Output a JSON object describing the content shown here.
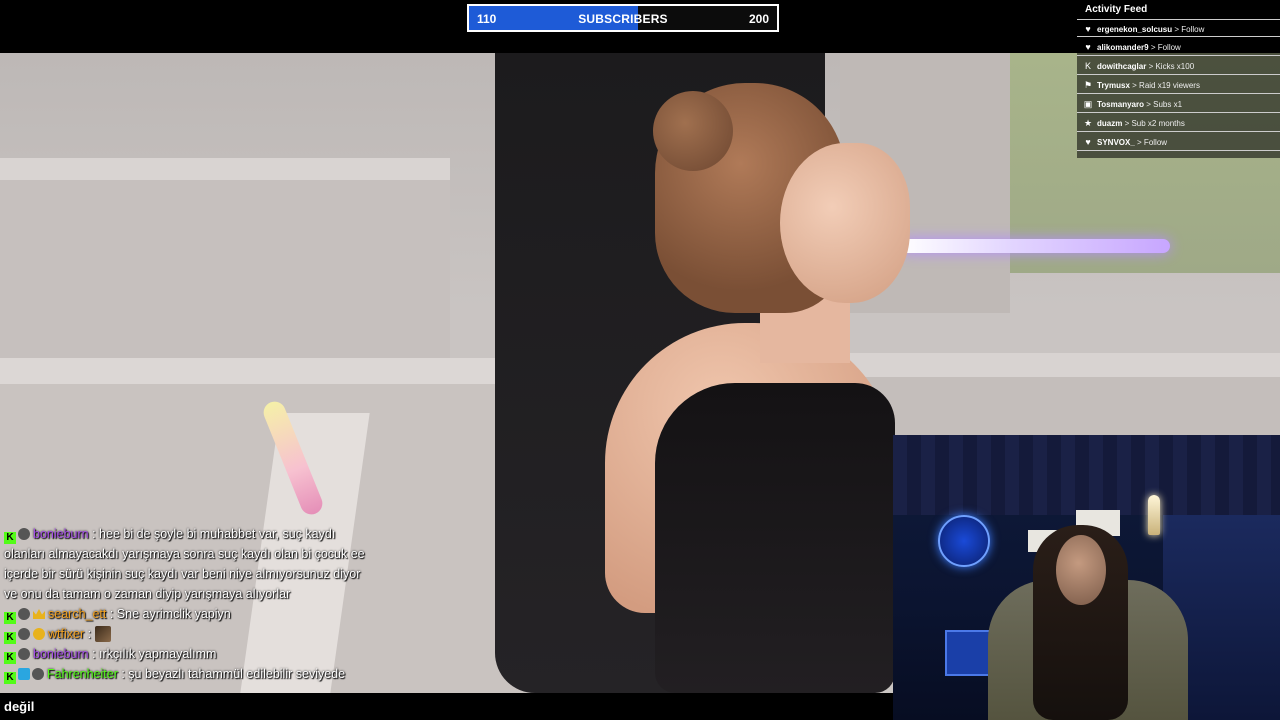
{
  "subscribers": {
    "current": "110",
    "label": "SUBSCRIBERS",
    "goal": "200",
    "progress_fraction": 0.55,
    "fill_color": "#1e5bd7"
  },
  "activity_feed": {
    "title": "Activity Feed",
    "items": [
      {
        "icon": "heart-icon",
        "glyph": "♥",
        "user": "ergenekon_solcusu",
        "action": "> Follow"
      },
      {
        "icon": "heart-icon",
        "glyph": "♥",
        "user": "alikomander9",
        "action": "> Follow"
      },
      {
        "icon": "kick-icon",
        "glyph": "K",
        "user": "dowithcaglar",
        "action": "> Kicks x100"
      },
      {
        "icon": "raid-icon",
        "glyph": "⚑",
        "user": "Trymusx",
        "action": "> Raid x19 viewers"
      },
      {
        "icon": "gift-icon",
        "glyph": "▣",
        "user": "Tosmanyaro",
        "action": "> Subs x1"
      },
      {
        "icon": "star-icon",
        "glyph": "★",
        "user": "duazm",
        "action": "> Sub x2 months"
      },
      {
        "icon": "heart-icon",
        "glyph": "♥",
        "user": "SYNVOX_",
        "action": "> Follow"
      }
    ]
  },
  "chat": {
    "messages": [
      {
        "user": "bonieburn",
        "text": ": hee bi de şoyle bi muhabbet var, suç kaydı"
      },
      {
        "user": "",
        "text": "olanları almayacakdı yarışmaya sonra suç kaydı olan bi çocuk ee"
      },
      {
        "user": "",
        "text": "içerde bir sürü kişinin suç kaydı var beni niye almıyorsunuz diyor"
      },
      {
        "user": "",
        "text": "ve onu da tamam o zaman diyip yarışmaya alıyorlar"
      },
      {
        "user": "search_ett",
        "text": ": Sne ayrimclik yapiyn"
      },
      {
        "user": "wtfixer",
        "text": ":"
      },
      {
        "user": "bonieburn",
        "text": ": ırkçılık yapmayalımm"
      },
      {
        "user": "Fahrenheiter",
        "text": ": şu beyazlı tahammül edilebilir seviyede"
      }
    ]
  },
  "subtitle": {
    "text": "değil"
  }
}
